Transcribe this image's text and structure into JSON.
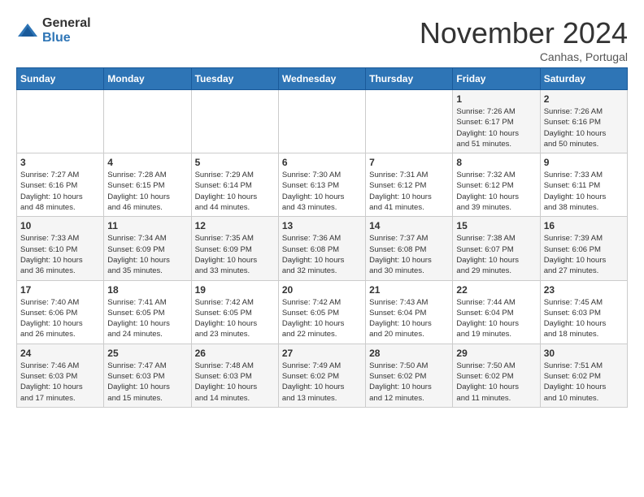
{
  "header": {
    "logo_general": "General",
    "logo_blue": "Blue",
    "month": "November 2024",
    "location": "Canhas, Portugal"
  },
  "weekdays": [
    "Sunday",
    "Monday",
    "Tuesday",
    "Wednesday",
    "Thursday",
    "Friday",
    "Saturday"
  ],
  "weeks": [
    [
      {
        "day": "",
        "info": ""
      },
      {
        "day": "",
        "info": ""
      },
      {
        "day": "",
        "info": ""
      },
      {
        "day": "",
        "info": ""
      },
      {
        "day": "",
        "info": ""
      },
      {
        "day": "1",
        "info": "Sunrise: 7:26 AM\nSunset: 6:17 PM\nDaylight: 10 hours\nand 51 minutes."
      },
      {
        "day": "2",
        "info": "Sunrise: 7:26 AM\nSunset: 6:16 PM\nDaylight: 10 hours\nand 50 minutes."
      }
    ],
    [
      {
        "day": "3",
        "info": "Sunrise: 7:27 AM\nSunset: 6:16 PM\nDaylight: 10 hours\nand 48 minutes."
      },
      {
        "day": "4",
        "info": "Sunrise: 7:28 AM\nSunset: 6:15 PM\nDaylight: 10 hours\nand 46 minutes."
      },
      {
        "day": "5",
        "info": "Sunrise: 7:29 AM\nSunset: 6:14 PM\nDaylight: 10 hours\nand 44 minutes."
      },
      {
        "day": "6",
        "info": "Sunrise: 7:30 AM\nSunset: 6:13 PM\nDaylight: 10 hours\nand 43 minutes."
      },
      {
        "day": "7",
        "info": "Sunrise: 7:31 AM\nSunset: 6:12 PM\nDaylight: 10 hours\nand 41 minutes."
      },
      {
        "day": "8",
        "info": "Sunrise: 7:32 AM\nSunset: 6:12 PM\nDaylight: 10 hours\nand 39 minutes."
      },
      {
        "day": "9",
        "info": "Sunrise: 7:33 AM\nSunset: 6:11 PM\nDaylight: 10 hours\nand 38 minutes."
      }
    ],
    [
      {
        "day": "10",
        "info": "Sunrise: 7:33 AM\nSunset: 6:10 PM\nDaylight: 10 hours\nand 36 minutes."
      },
      {
        "day": "11",
        "info": "Sunrise: 7:34 AM\nSunset: 6:09 PM\nDaylight: 10 hours\nand 35 minutes."
      },
      {
        "day": "12",
        "info": "Sunrise: 7:35 AM\nSunset: 6:09 PM\nDaylight: 10 hours\nand 33 minutes."
      },
      {
        "day": "13",
        "info": "Sunrise: 7:36 AM\nSunset: 6:08 PM\nDaylight: 10 hours\nand 32 minutes."
      },
      {
        "day": "14",
        "info": "Sunrise: 7:37 AM\nSunset: 6:08 PM\nDaylight: 10 hours\nand 30 minutes."
      },
      {
        "day": "15",
        "info": "Sunrise: 7:38 AM\nSunset: 6:07 PM\nDaylight: 10 hours\nand 29 minutes."
      },
      {
        "day": "16",
        "info": "Sunrise: 7:39 AM\nSunset: 6:06 PM\nDaylight: 10 hours\nand 27 minutes."
      }
    ],
    [
      {
        "day": "17",
        "info": "Sunrise: 7:40 AM\nSunset: 6:06 PM\nDaylight: 10 hours\nand 26 minutes."
      },
      {
        "day": "18",
        "info": "Sunrise: 7:41 AM\nSunset: 6:05 PM\nDaylight: 10 hours\nand 24 minutes."
      },
      {
        "day": "19",
        "info": "Sunrise: 7:42 AM\nSunset: 6:05 PM\nDaylight: 10 hours\nand 23 minutes."
      },
      {
        "day": "20",
        "info": "Sunrise: 7:42 AM\nSunset: 6:05 PM\nDaylight: 10 hours\nand 22 minutes."
      },
      {
        "day": "21",
        "info": "Sunrise: 7:43 AM\nSunset: 6:04 PM\nDaylight: 10 hours\nand 20 minutes."
      },
      {
        "day": "22",
        "info": "Sunrise: 7:44 AM\nSunset: 6:04 PM\nDaylight: 10 hours\nand 19 minutes."
      },
      {
        "day": "23",
        "info": "Sunrise: 7:45 AM\nSunset: 6:03 PM\nDaylight: 10 hours\nand 18 minutes."
      }
    ],
    [
      {
        "day": "24",
        "info": "Sunrise: 7:46 AM\nSunset: 6:03 PM\nDaylight: 10 hours\nand 17 minutes."
      },
      {
        "day": "25",
        "info": "Sunrise: 7:47 AM\nSunset: 6:03 PM\nDaylight: 10 hours\nand 15 minutes."
      },
      {
        "day": "26",
        "info": "Sunrise: 7:48 AM\nSunset: 6:03 PM\nDaylight: 10 hours\nand 14 minutes."
      },
      {
        "day": "27",
        "info": "Sunrise: 7:49 AM\nSunset: 6:02 PM\nDaylight: 10 hours\nand 13 minutes."
      },
      {
        "day": "28",
        "info": "Sunrise: 7:50 AM\nSunset: 6:02 PM\nDaylight: 10 hours\nand 12 minutes."
      },
      {
        "day": "29",
        "info": "Sunrise: 7:50 AM\nSunset: 6:02 PM\nDaylight: 10 hours\nand 11 minutes."
      },
      {
        "day": "30",
        "info": "Sunrise: 7:51 AM\nSunset: 6:02 PM\nDaylight: 10 hours\nand 10 minutes."
      }
    ]
  ]
}
